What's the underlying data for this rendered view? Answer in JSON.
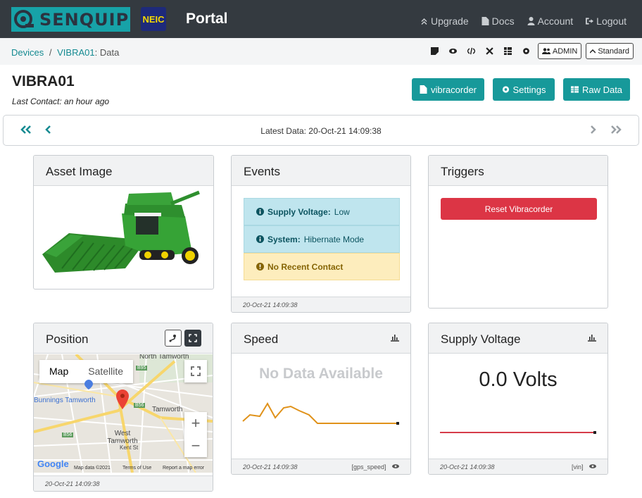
{
  "navbar": {
    "logo_text": "SENQUIP",
    "partner_logo": "NEIC",
    "portal_title": "Portal",
    "links": [
      {
        "label": "Upgrade",
        "icon": "chevron-up-icon"
      },
      {
        "label": "Docs",
        "icon": "document-icon"
      },
      {
        "label": "Account",
        "icon": "user-icon"
      },
      {
        "label": "Logout",
        "icon": "logout-icon"
      }
    ]
  },
  "breadcrumb": {
    "devices": "Devices",
    "separator": "/",
    "device": "VIBRA01",
    "page": ": Data"
  },
  "toolbar": {
    "admin_label": "ADMIN",
    "standard_label": "Standard"
  },
  "device": {
    "name": "VIBRA01",
    "last_contact": "Last Contact: an hour ago"
  },
  "actions": {
    "vibracorder": "vibracorder",
    "settings": "Settings",
    "raw_data": "Raw Data"
  },
  "pager": {
    "latest": "Latest Data: 20-Oct-21 14:09:38"
  },
  "cards": {
    "asset": {
      "title": "Asset Image"
    },
    "events": {
      "title": "Events",
      "items": [
        {
          "label": "Supply Voltage:",
          "value": "Low",
          "bg": "#bfe5ee",
          "icon_color": "#0c5460"
        },
        {
          "label": "System:",
          "value": "Hibernate Mode",
          "bg": "#bfe5ee",
          "icon_color": "#0c5460"
        },
        {
          "label": "No Recent Contact",
          "value": "",
          "bg": "#fdedbd",
          "icon_color": "#856404"
        }
      ],
      "timestamp": "20-Oct-21 14:09:38"
    },
    "triggers": {
      "title": "Triggers",
      "reset_button": "Reset Vibracorder"
    },
    "position": {
      "title": "Position",
      "map_type": [
        "Map",
        "Satellite"
      ],
      "places": [
        "North Tamworth",
        "Bunnings Tamworth",
        "Tamworth",
        "West Tamworth",
        "Kent St"
      ],
      "roads": [
        "B95",
        "B56",
        "B56"
      ],
      "google": "Google",
      "attribution": [
        "Map data ©2021",
        "Terms of Use",
        "Report a map error"
      ],
      "timestamp": "20-Oct-21 14:09:38"
    },
    "speed": {
      "title": "Speed",
      "no_data": "No Data Available",
      "timestamp": "20-Oct-21 14:09:38",
      "source": "[gps_speed]",
      "line_color": "#e0921a"
    },
    "supply": {
      "title": "Supply Voltage",
      "value": "0.0 Volts",
      "timestamp": "20-Oct-21 14:09:38",
      "source": "[vin]",
      "line_color": "#d63c4a"
    }
  },
  "colors": {
    "teal": "#17999a",
    "danger": "#dc3545",
    "navbar": "#343a40"
  }
}
